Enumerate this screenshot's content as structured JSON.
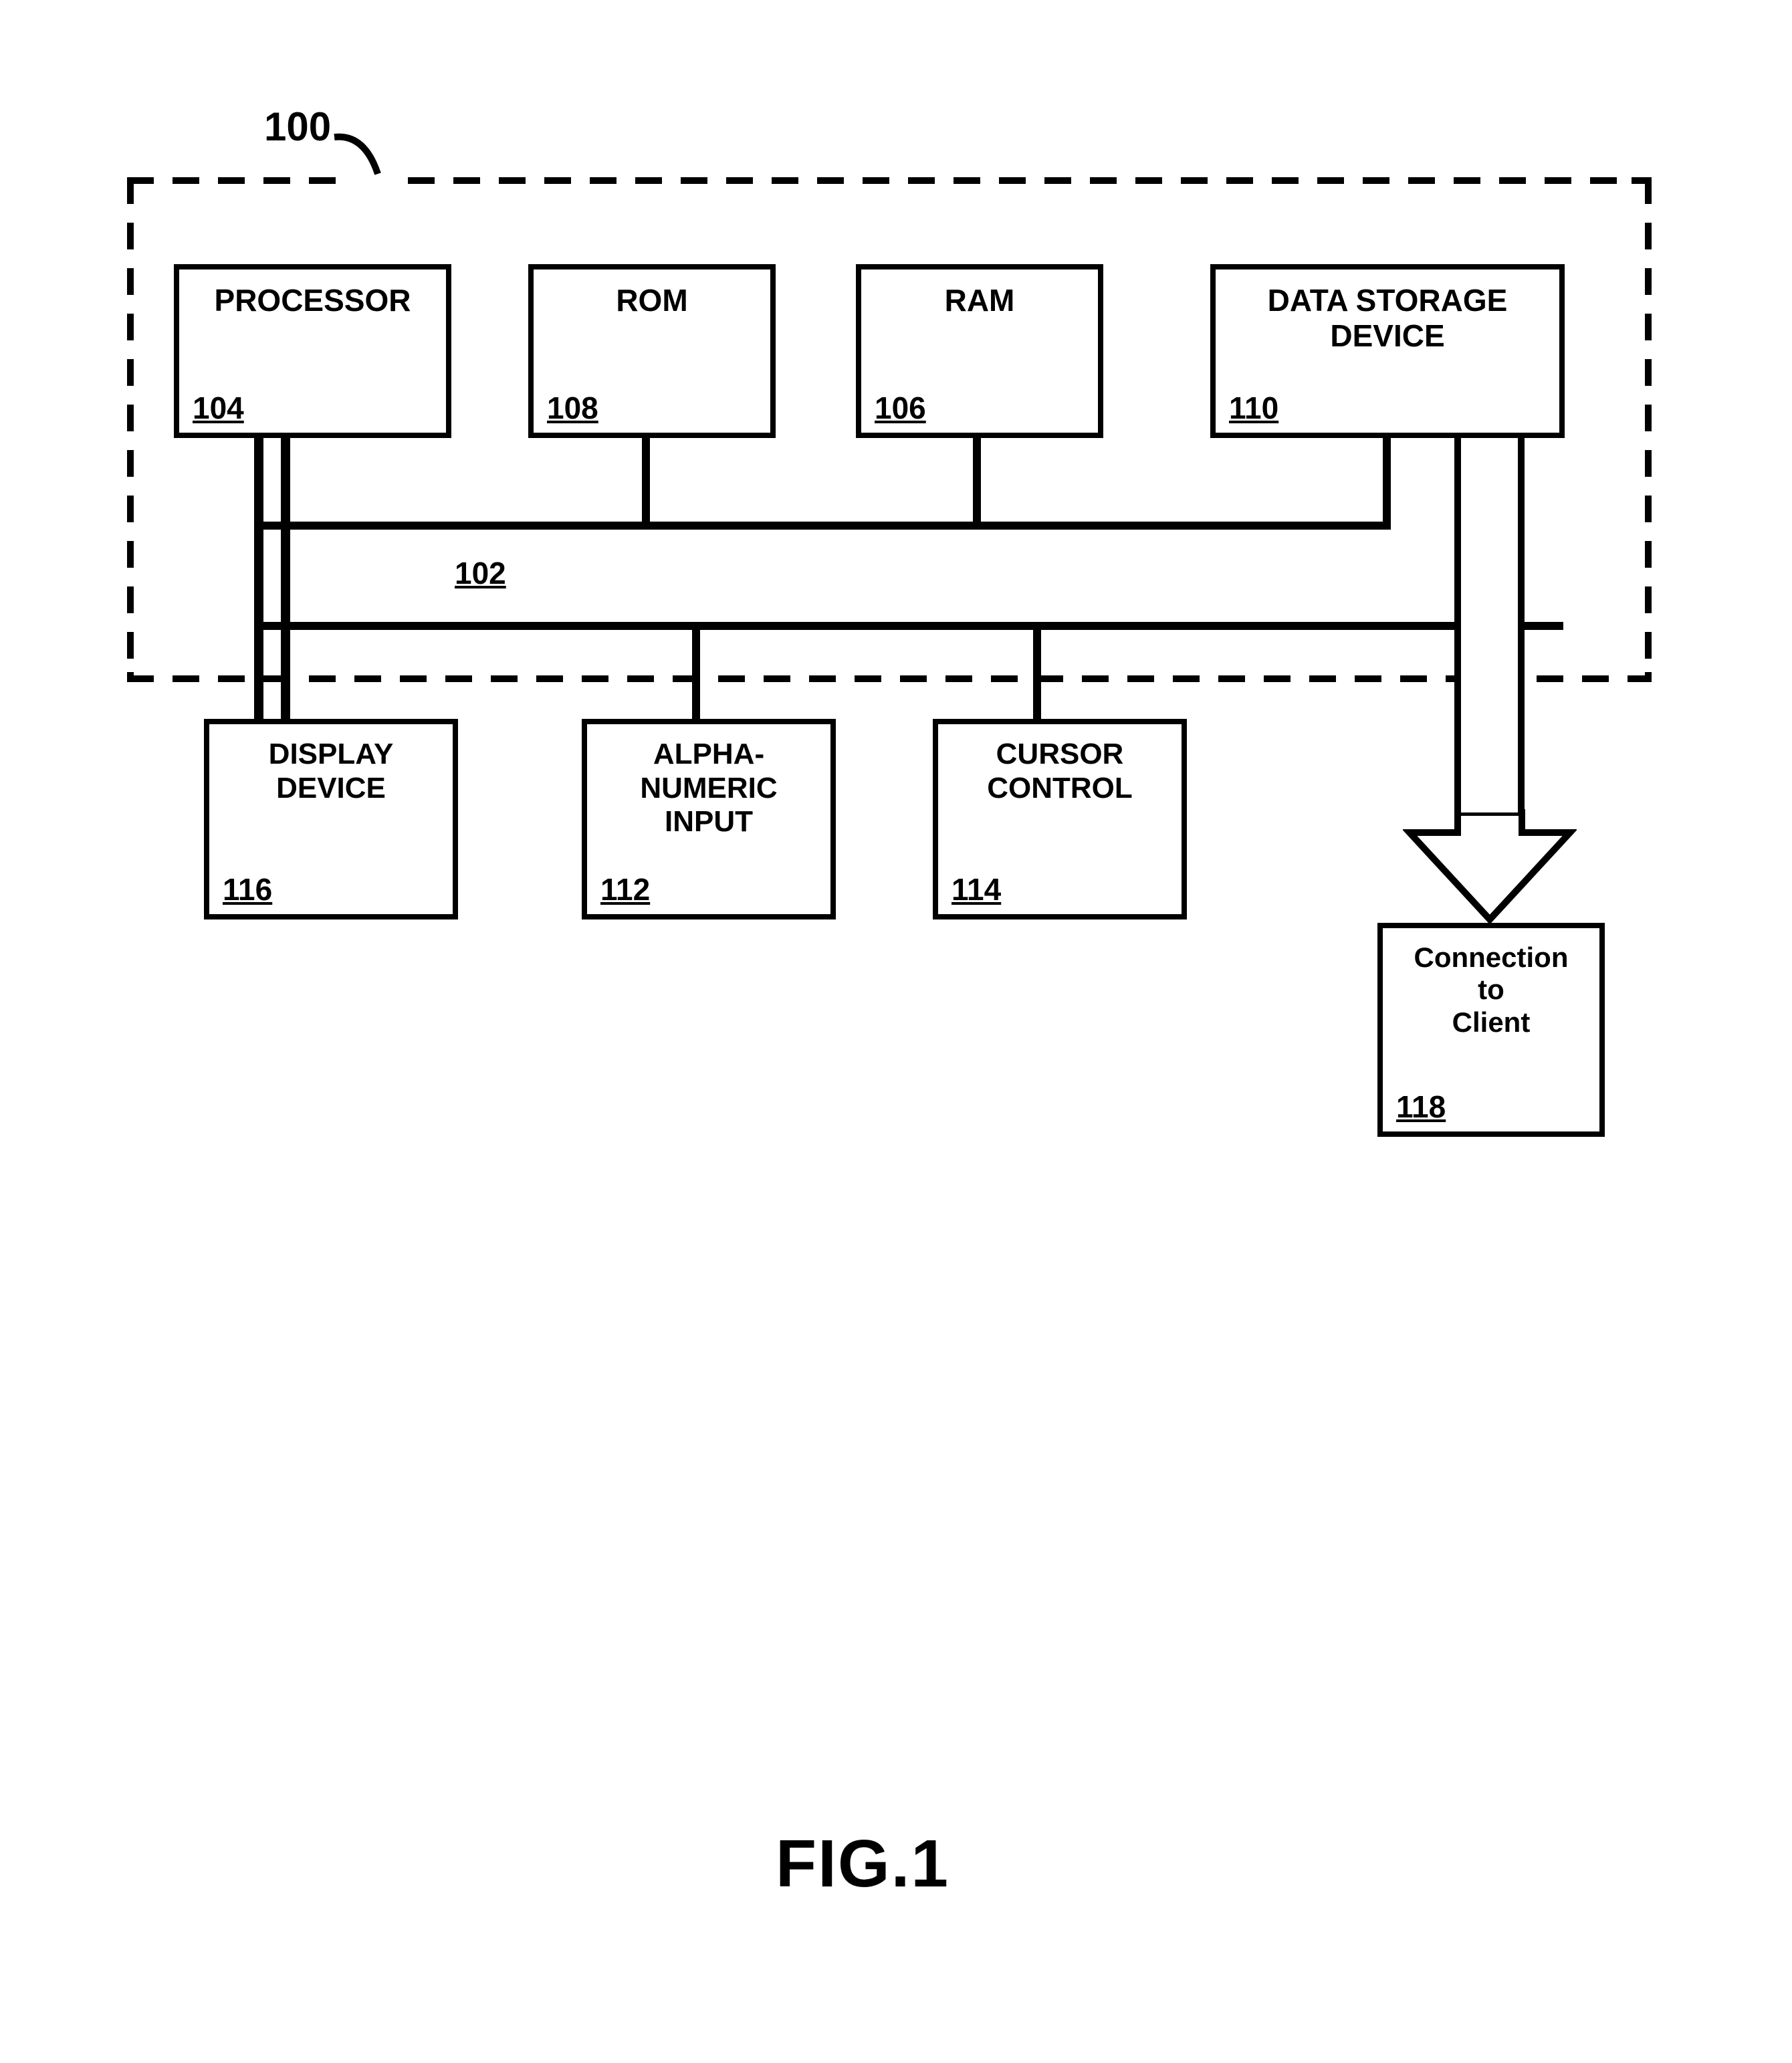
{
  "system": {
    "ref": "100"
  },
  "bus": {
    "ref": "102"
  },
  "blocks": {
    "processor": {
      "label": "PROCESSOR",
      "ref": "104"
    },
    "rom": {
      "label": "ROM",
      "ref": "108"
    },
    "ram": {
      "label": "RAM",
      "ref": "106"
    },
    "storage": {
      "label": "DATA STORAGE\nDEVICE",
      "ref": "110"
    },
    "display": {
      "label": "DISPLAY\nDEVICE",
      "ref": "116"
    },
    "alphanum": {
      "label": "ALPHA-\nNUMERIC\nINPUT",
      "ref": "112"
    },
    "cursor": {
      "label": "CURSOR\nCONTROL",
      "ref": "114"
    },
    "connection": {
      "label": "Connection\nto\nClient",
      "ref": "118"
    }
  },
  "figure": {
    "label": "FIG.1"
  }
}
